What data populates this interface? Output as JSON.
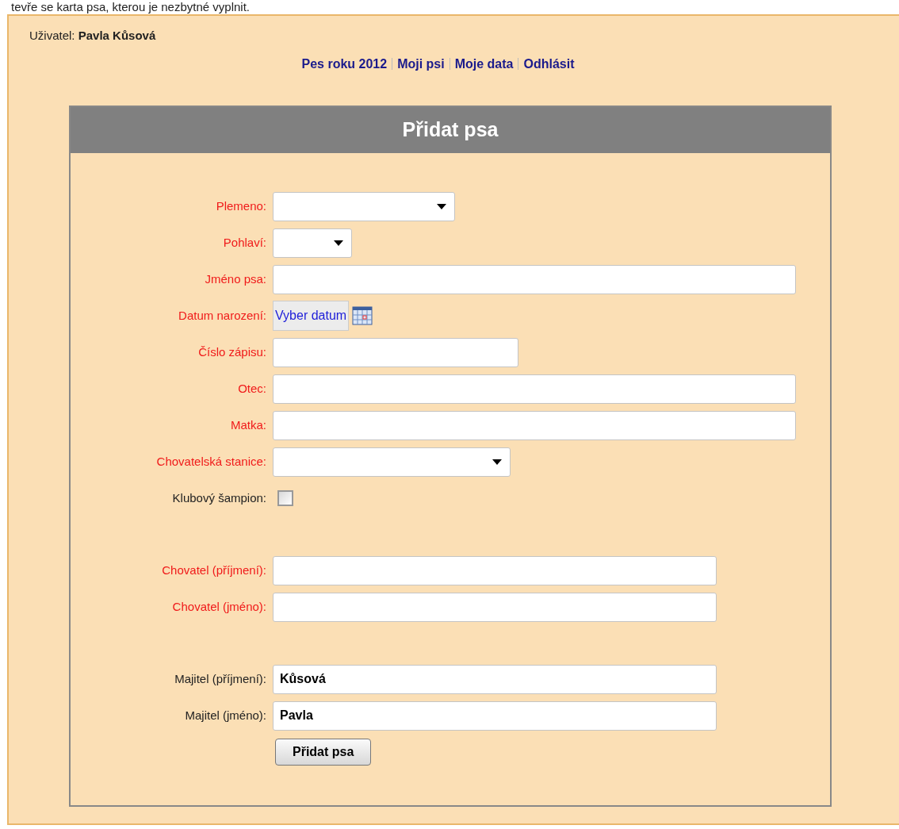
{
  "intro": "tevře se karta psa, kterou je nezbytné vyplnit.",
  "user": {
    "label": "Uživatel:",
    "name": "Pavla Kůsová"
  },
  "nav": [
    {
      "label": "Pes roku 2012"
    },
    {
      "label": "Moji psi"
    },
    {
      "label": "Moje data"
    },
    {
      "label": "Odhlásit"
    }
  ],
  "form": {
    "title": "Přidat psa",
    "groups": [
      {
        "fields": [
          {
            "label": "Plemeno:",
            "kind": "select",
            "required": true
          },
          {
            "label": "Pohlaví:",
            "kind": "select",
            "required": true
          },
          {
            "label": "Jméno psa:",
            "kind": "text",
            "required": true
          },
          {
            "label": "Datum narození:",
            "kind": "date",
            "required": true,
            "button": "Vyber datum"
          },
          {
            "label": "Číslo zápisu:",
            "kind": "text",
            "required": true
          },
          {
            "label": "Otec:",
            "kind": "text",
            "required": true
          },
          {
            "label": "Matka:",
            "kind": "text",
            "required": true
          },
          {
            "label": "Chovatelská stanice:",
            "kind": "select",
            "required": true
          },
          {
            "label": "Klubový šampion:",
            "kind": "checkbox",
            "required": false,
            "checked": false
          }
        ]
      },
      {
        "fields": [
          {
            "label": "Chovatel (příjmení):",
            "kind": "text",
            "required": true
          },
          {
            "label": "Chovatel (jméno):",
            "kind": "text",
            "required": true
          }
        ]
      },
      {
        "fields": [
          {
            "label": "Majitel (příjmení):",
            "kind": "text",
            "required": false,
            "value": "Kůsová"
          },
          {
            "label": "Majitel (jméno):",
            "kind": "text",
            "required": false,
            "value": "Pavla"
          }
        ]
      }
    ],
    "submit": "Přidat psa"
  }
}
